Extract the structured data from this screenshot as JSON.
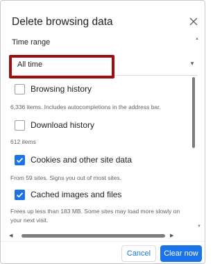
{
  "dialog": {
    "title": "Delete browsing data",
    "close_icon": "close-icon"
  },
  "time_range": {
    "label": "Time range",
    "selected": "All time",
    "arrow_icon": "chevron-down-icon"
  },
  "options": [
    {
      "label": "Browsing history",
      "checked": false,
      "description": "6,336 items. Includes autocompletions in the address bar."
    },
    {
      "label": "Download history",
      "checked": false,
      "description": "612 items"
    },
    {
      "label": "Cookies and other site data",
      "checked": true,
      "description": "From 59 sites. Signs you out of most sites."
    },
    {
      "label": "Cached images and files",
      "checked": true,
      "description": "Frees up less than 183 MB. Some sites may load more slowly on your next visit."
    }
  ],
  "buttons": {
    "cancel": "Cancel",
    "clear": "Clear now"
  },
  "colors": {
    "accent": "#1a73e8",
    "highlight": "#9c0e12"
  }
}
